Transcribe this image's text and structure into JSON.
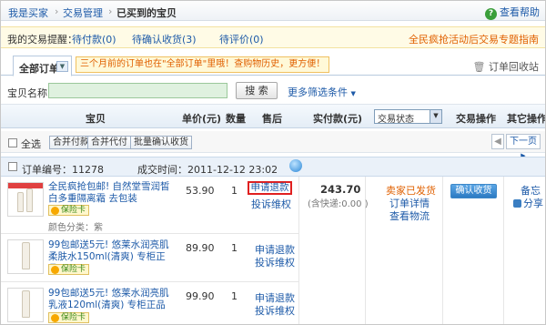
{
  "breadcrumb": {
    "item1": "我是买家",
    "sep": "›",
    "item2": "交易管理",
    "item3": "已买到的宝贝"
  },
  "help": {
    "icon": "question-icon",
    "label": "查看帮助"
  },
  "reminder": {
    "label": "我的交易提醒：",
    "pay": "待付款(0)",
    "confirm": "待确认收货(3)",
    "review": "待评价(0)",
    "promo": "全民疯抢活动后交易专题指南"
  },
  "tabs": {
    "all_orders": "全部订单",
    "tip": "三个月前的订单也在\"全部订单\"里哦！查购物历史，更方便！",
    "recycle": "订单回收站"
  },
  "search": {
    "label": "宝贝名称：",
    "button": "搜 索",
    "more": "更多筛选条件"
  },
  "table_header": {
    "item": "宝贝",
    "unit_price": "单价(元)",
    "quantity": "数量",
    "after_sale": "售后",
    "paid": "实付款(元)",
    "status_select": "交易状态",
    "operation": "交易操作",
    "other": "其它操作"
  },
  "actions": {
    "select_all": "全选",
    "merge_pay": "合并付款",
    "merge_proxy": "合并代付",
    "batch_confirm": "批量确认收货",
    "prev": "◀",
    "next": "下一页"
  },
  "order": {
    "number": "订单编号：11278",
    "time": "成交时间：2011-12-12 23:02",
    "total": "243.70",
    "shipping": "(含快递:0.00 )",
    "status": "卖家已发货",
    "detail": "订单详情",
    "logistics": "查看物流",
    "confirm_button": "确认收货",
    "note": "备忘",
    "share": "分享"
  },
  "items": [
    {
      "title": "全民疯抢包邮! 自然堂雪润皙白多重隔离霜 去包装",
      "insurance": "保险卡",
      "attr": "颜色分类：紫",
      "price": "53.90",
      "qty": "1",
      "refund": "申请退款",
      "complaint": "投诉维权"
    },
    {
      "title": "99包邮送5元! 悠莱水润亮肌柔肤水150ml(清爽) 专柜正品",
      "insurance": "保险卡",
      "price": "89.90",
      "qty": "1",
      "refund": "申请退款",
      "complaint": "投诉维权"
    },
    {
      "title": "99包邮送5元! 悠莱水润亮肌乳液120ml(清爽) 专柜正品",
      "insurance": "保险卡",
      "price": "99.90",
      "qty": "1",
      "refund": "申请退款",
      "complaint": "投诉维权"
    }
  ],
  "colors": {
    "link": "#1d5aa8",
    "highlight": "#e02020",
    "orange": "#e06000",
    "green_input": "#dff1df"
  }
}
